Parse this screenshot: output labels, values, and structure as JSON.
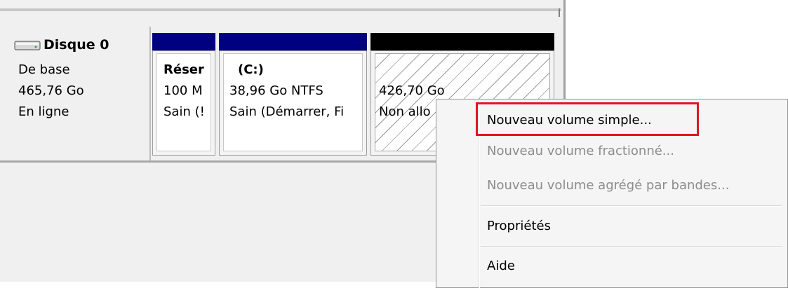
{
  "disk": {
    "icon": "hard-disk-icon",
    "name": "Disque 0",
    "type": "De base",
    "size": "465,76 Go",
    "status": "En ligne"
  },
  "partitions": [
    {
      "name": "Réser",
      "size": "100 M",
      "status": "Sain (!",
      "bar_color": "#000080"
    },
    {
      "name": "(C:)",
      "size": "38,96 Go NTFS",
      "status": "Sain (Démarrer, Fi",
      "bar_color": "#000080"
    },
    {
      "name": "",
      "size": "426,70 Go",
      "status": "Non allo",
      "bar_color": "#000000"
    }
  ],
  "context_menu": {
    "items": [
      {
        "label": "Nouveau volume simple...",
        "enabled": true
      },
      {
        "label": "Nouveau volume fractionné...",
        "enabled": false
      },
      {
        "label": "Nouveau volume agrégé par bandes...",
        "enabled": false
      },
      {
        "label": "Propriétés",
        "enabled": true
      },
      {
        "label": "Aide",
        "enabled": true
      }
    ]
  },
  "colors": {
    "allocated_bar": "#000080",
    "unallocated_bar": "#000000",
    "highlight": "#e0161e"
  }
}
